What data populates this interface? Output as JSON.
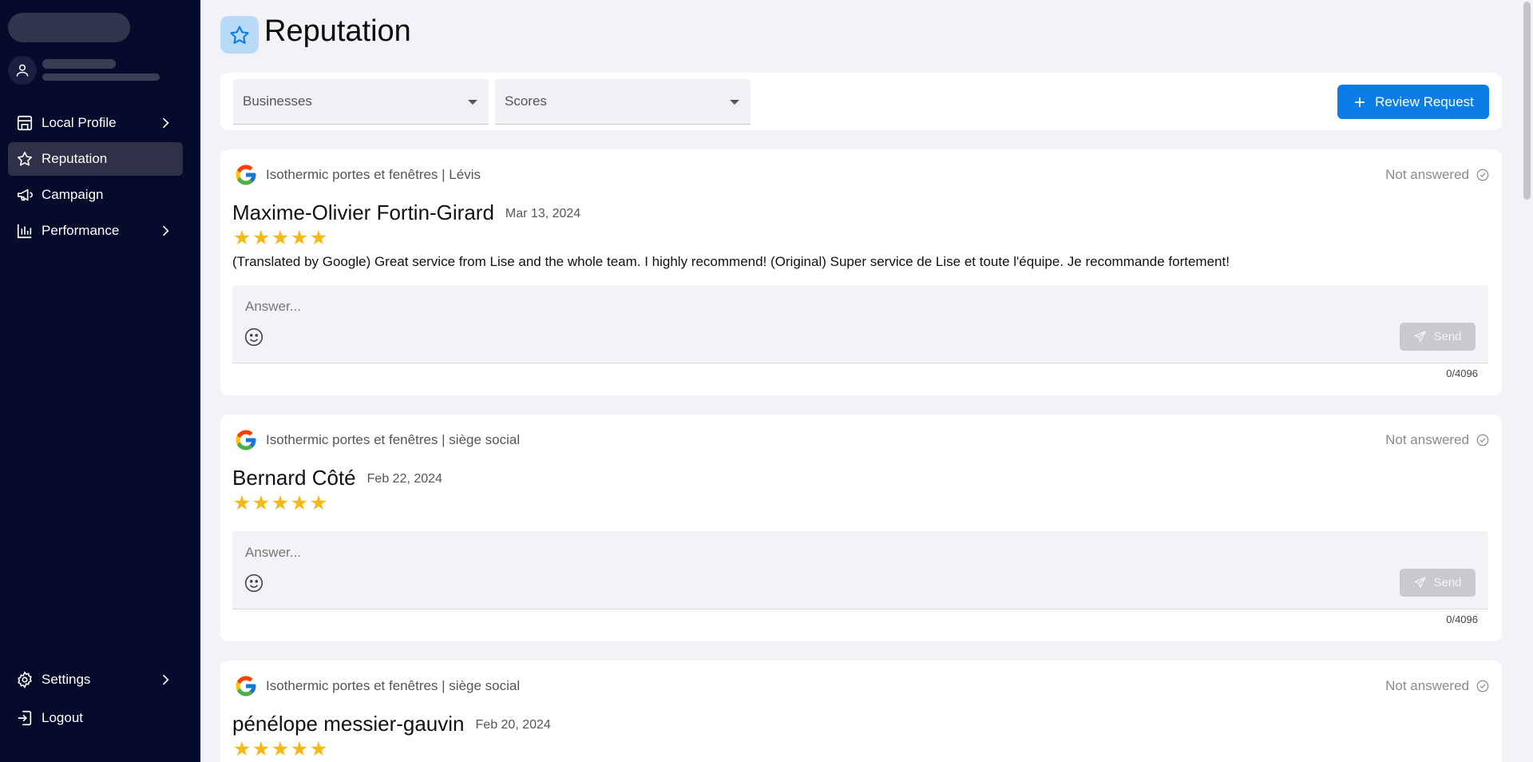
{
  "sidebar": {
    "items": [
      {
        "label": "Local Profile",
        "icon": "store-icon"
      },
      {
        "label": "Reputation",
        "icon": "star-outline-icon"
      },
      {
        "label": "Campaign",
        "icon": "megaphone-icon"
      },
      {
        "label": "Performance",
        "icon": "bar-chart-icon"
      }
    ],
    "settings_label": "Settings",
    "logout_label": "Logout"
  },
  "page": {
    "title": "Reputation",
    "title_icon": "star-outline-icon"
  },
  "filters": {
    "businesses_placeholder": "Businesses",
    "scores_placeholder": "Scores",
    "review_request_label": "Review Request"
  },
  "reviews": [
    {
      "business": "Isothermic portes et fenêtres | Lévis",
      "status": "Not answered",
      "reviewer": "Maxime-Olivier Fortin-Girard",
      "date": "Mar 13, 2024",
      "rating": 5,
      "text": "(Translated by Google) Great service from Lise and the whole team. I highly recommend! (Original) Super service de Lise et toute l'équipe. Je recommande fortement!",
      "answer_placeholder": "Answer...",
      "send_label": "Send",
      "counter": "0/4096"
    },
    {
      "business": "Isothermic portes et fenêtres | siège social",
      "status": "Not answered",
      "reviewer": "Bernard Côté",
      "date": "Feb 22, 2024",
      "rating": 5,
      "text": "",
      "answer_placeholder": "Answer...",
      "send_label": "Send",
      "counter": "0/4096"
    },
    {
      "business": "Isothermic portes et fenêtres | siège social",
      "status": "Not answered",
      "reviewer": "pénélope messier-gauvin",
      "date": "Feb 20, 2024",
      "rating": 5
    }
  ],
  "colors": {
    "sidebar_bg": "#070b2b",
    "primary": "#0a7ee6",
    "star": "#f5b913"
  }
}
